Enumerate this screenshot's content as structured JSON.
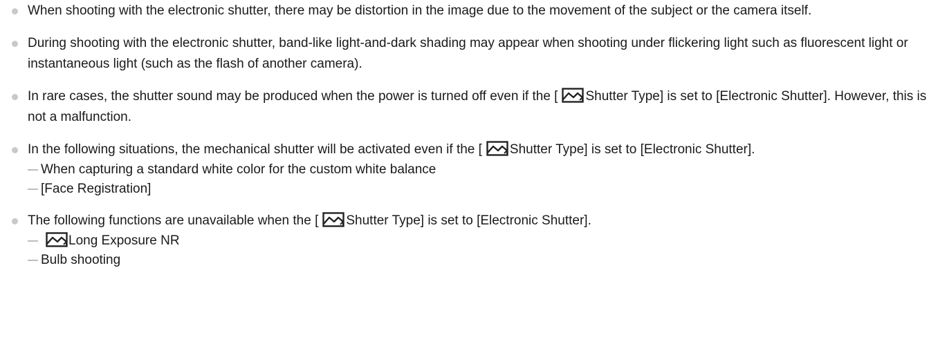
{
  "icons": {
    "bullet": "gray-dot-bullet-icon",
    "sub_bullet": "dash-bullet-icon",
    "still_image_mode": "still-image-mode-icon"
  },
  "colors": {
    "text": "#1a1a1a",
    "bullet": "#c9c9c9",
    "dash": "#bdbdbd",
    "icon_stroke": "#222222"
  },
  "notes": [
    {
      "text": "When shooting with the electronic shutter, there may be distortion in the image due to the movement of the subject or the camera itself."
    },
    {
      "text": "During shooting with the electronic shutter, band-like light-and-dark shading may appear when shooting under flickering light such as fluorescent light or instantaneous light (such as the flash of another camera)."
    },
    {
      "before": "In rare cases, the shutter sound may be produced when the power is turned off even if the [",
      "after": "Shutter Type] is set to [Electronic Shutter]. However, this is not a malfunction."
    },
    {
      "before": "In the following situations, the mechanical shutter will be activated even if the [",
      "after": "Shutter Type] is set to [Electronic Shutter].",
      "sub_items": [
        "When capturing a standard white color for the custom white balance",
        "[Face Registration]"
      ]
    },
    {
      "before": "The following functions are unavailable when the [",
      "after": "Shutter Type] is set to [Electronic Shutter].",
      "sub_items": [
        "Long Exposure NR",
        "Bulb shooting"
      ]
    }
  ]
}
